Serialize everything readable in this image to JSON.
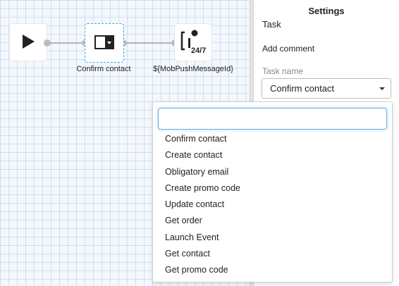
{
  "canvas": {
    "nodes": [
      {
        "id": "start",
        "label": "",
        "icon": "play-icon"
      },
      {
        "id": "confirm",
        "label": "Confirm contact",
        "icon": "task-dropdown-icon"
      },
      {
        "id": "push",
        "label": "${MobPushMessageId}",
        "icon": "push-24-7-icon",
        "badge": "24/7"
      }
    ]
  },
  "settings": {
    "title": "Settings",
    "task_label": "Task",
    "add_comment": "Add comment",
    "task_name_label": "Task name",
    "task_name_value": "Confirm contact"
  },
  "dropdown": {
    "search_value": "",
    "search_placeholder": "",
    "options": [
      "Confirm contact",
      "Create contact",
      "Obligatory email",
      "Create promo code",
      "Update contact",
      "Get order",
      "Launch Event",
      "Get contact",
      "Get promo code"
    ]
  },
  "colors": {
    "selection_border": "#38a8e6",
    "search_focus": "#66afe9",
    "grid": "#cfdfee",
    "connector": "#b0b4b8"
  }
}
